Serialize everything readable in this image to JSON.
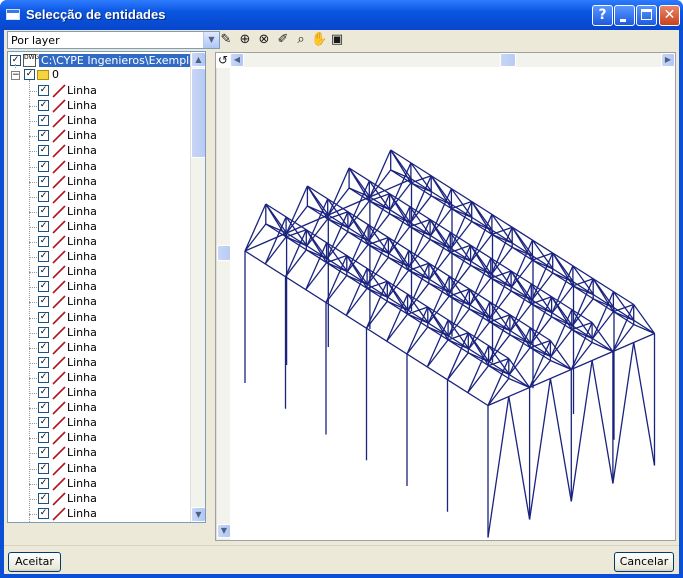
{
  "window": {
    "title": "Selecção de entidades",
    "help_label": "?",
    "colors": {
      "titlebar": "#0a55e0",
      "structure": "#1a237e",
      "selection": "#316ac5"
    }
  },
  "filter": {
    "selected": "Por layer"
  },
  "tree": {
    "root_label": "C:\\CYPE Ingenieros\\Exemplos\\",
    "layer_label": "0",
    "item_label": "Linha"
  },
  "toolbar": {
    "icons": [
      "select-by-window-icon",
      "zoom-window-icon",
      "zoom-extents-icon",
      "measure-icon",
      "find-icon",
      "pan-icon",
      "views-icon",
      "undo-view-icon"
    ]
  },
  "buttons": {
    "accept": "Aceitar",
    "cancel": "Cancelar"
  }
}
